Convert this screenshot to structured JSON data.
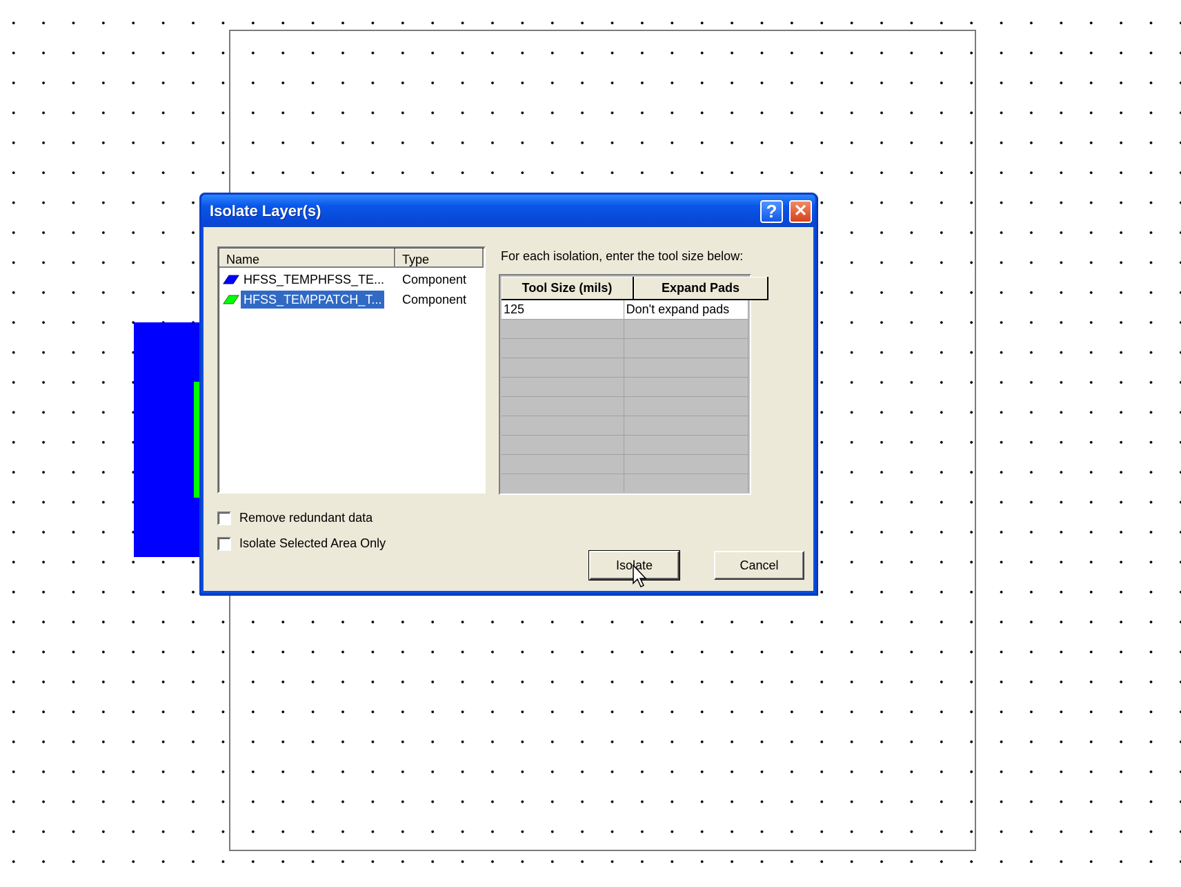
{
  "dialog": {
    "title": "Isolate Layer(s)",
    "help_glyph": "?",
    "close_glyph": "✕",
    "layer_list": {
      "columns": [
        "Name",
        "Type"
      ],
      "rows": [
        {
          "name": "HFSS_TEMPHFSS_TE...",
          "type": "Component",
          "icon_color": "#0000ff",
          "selected": false
        },
        {
          "name": "HFSS_TEMPPATCH_T...",
          "type": "Component",
          "icon_color": "#00ff00",
          "selected": true
        }
      ]
    },
    "instruction": "For each isolation, enter the tool size below:",
    "tool_grid": {
      "columns": [
        "Tool Size (mils)",
        "Expand Pads"
      ],
      "rows": [
        {
          "tool_size": "125",
          "expand_pads": "Don't expand pads"
        }
      ]
    },
    "options": {
      "remove_redundant": {
        "label": "Remove redundant data",
        "checked": false
      },
      "isolate_selected": {
        "label": "Isolate Selected Area Only",
        "checked": false
      }
    },
    "buttons": {
      "isolate": "Isolate",
      "cancel": "Cancel"
    }
  },
  "canvas": {
    "layer_colors": {
      "top": "#0000ff",
      "patch": "#00ff00"
    }
  }
}
